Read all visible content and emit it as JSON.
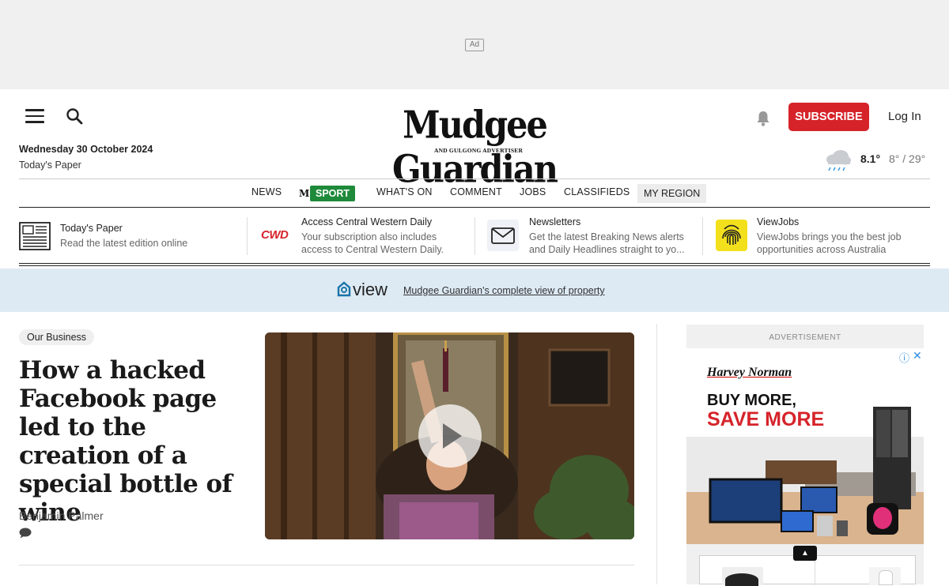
{
  "ad_top": {
    "tag": "Ad"
  },
  "header": {
    "date": "Wednesday 30 October 2024",
    "todays_paper": "Today's Paper",
    "logo_main": "Mudgee Guardian",
    "logo_sub": "AND GULGONG ADVERTISER",
    "subscribe": "SUBSCRIBE",
    "login": "Log In",
    "weather": {
      "temp": "8.1°",
      "range": "8° / 29°",
      "icon": "rain-cloud-icon"
    }
  },
  "nav": {
    "items": [
      "NEWS",
      "WHAT'S ON",
      "COMMENT",
      "JOBS",
      "CLASSIFIEDS",
      "MY REGION"
    ],
    "sport_badge": "M",
    "sport": "SPORT",
    "sport_color": "#1e8a3a"
  },
  "promos": [
    {
      "title": "Today's Paper",
      "desc": "Read the latest edition online",
      "icon": "newspaper-icon"
    },
    {
      "title": "Access Central Western Daily",
      "desc": "Your subscription also includes access to Central Western Daily.",
      "icon": "cwd-logo",
      "logo_text": "CWD"
    },
    {
      "title": "Newsletters",
      "desc": "Get the latest Breaking News alerts and Daily Headlines straight to yo...",
      "icon": "envelope-icon"
    },
    {
      "title": "ViewJobs",
      "desc": "ViewJobs brings you the best job opportunities across Australia",
      "icon": "fingerprint-icon"
    }
  ],
  "viewbar": {
    "logo": "view",
    "link": "Mudgee Guardian's complete view of property"
  },
  "article": {
    "badge": "Our Business",
    "headline": "How a hacked Facebook page led to the creation of a special bottle of wine",
    "author": "Benjamin Palmer"
  },
  "sidebar_ad": {
    "label": "ADVERTISEMENT",
    "brand": "Harvey Norman",
    "line1": "BUY MORE,",
    "line2": "SAVE MORE"
  },
  "colors": {
    "brand_red": "#d6232a",
    "view_blue": "#ddeaf4",
    "view_teal": "#1a73a8"
  }
}
